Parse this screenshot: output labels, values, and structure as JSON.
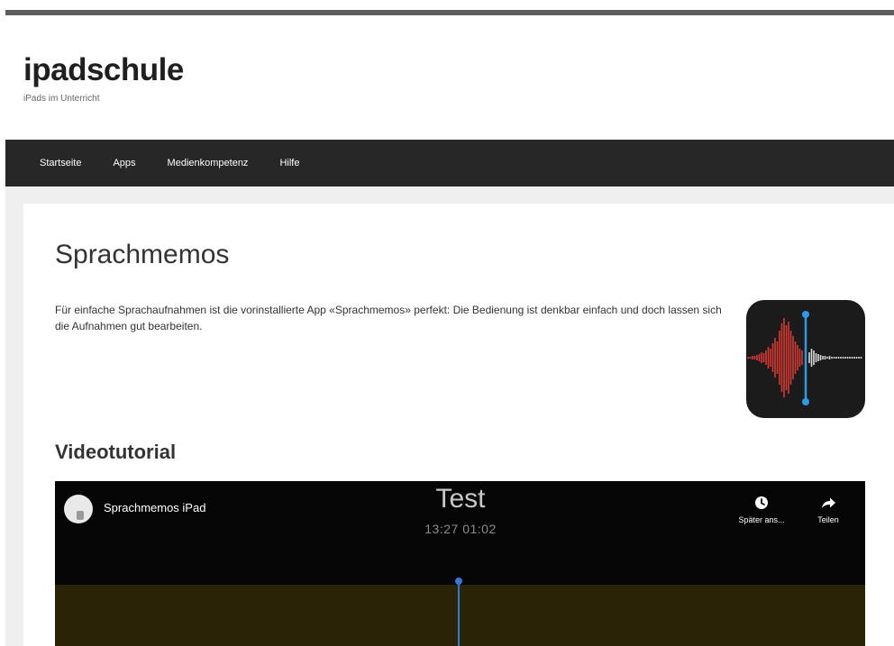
{
  "site": {
    "title": "ipadschule",
    "tagline": "iPads im Unterricht"
  },
  "nav": {
    "items": [
      {
        "label": "Startseite"
      },
      {
        "label": "Apps"
      },
      {
        "label": "Medienkompetenz"
      },
      {
        "label": "Hilfe"
      }
    ]
  },
  "page": {
    "title": "Sprachmemos",
    "intro": "Für einfache Sprachaufnahmen ist die vorinstallierte App «Sprachmemos» perfekt: Die Bedienung ist denkbar einfach und doch lassen sich die Aufnahmen gut bearbeiten.",
    "app_icon": "voice-memos-app-icon",
    "section_title": "Videotutorial"
  },
  "video": {
    "channel_title": "Sprachmemos iPad",
    "overlay_title": "Test",
    "overlay_time": "13:27  01:02",
    "actions": {
      "later_label": "Später ans...",
      "later_icon": "clock-icon",
      "share_label": "Teilen",
      "share_icon": "share-arrow-icon"
    }
  },
  "colors": {
    "nav_bg": "#272727",
    "waveform_red": "#d93a32",
    "playhead_blue": "#2e7ad6"
  }
}
